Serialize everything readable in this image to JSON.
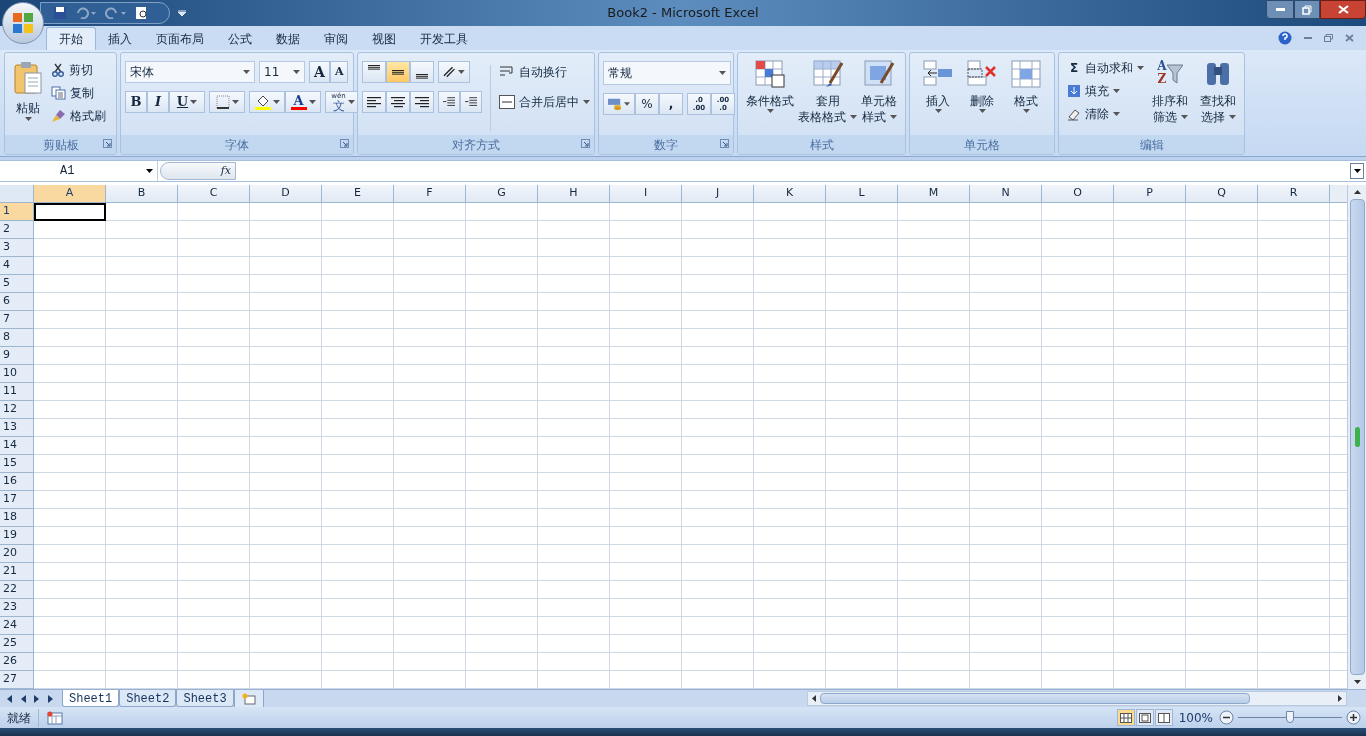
{
  "window": {
    "title": "Book2 - Microsoft Excel"
  },
  "tabs": [
    {
      "label": "开始",
      "selected": true
    },
    {
      "label": "插入",
      "selected": false
    },
    {
      "label": "页面布局",
      "selected": false
    },
    {
      "label": "公式",
      "selected": false
    },
    {
      "label": "数据",
      "selected": false
    },
    {
      "label": "审阅",
      "selected": false
    },
    {
      "label": "视图",
      "selected": false
    },
    {
      "label": "开发工具",
      "selected": false
    }
  ],
  "ribbon": {
    "groups": [
      {
        "kind": "clipboard",
        "label": "剪贴板",
        "paste": "粘贴",
        "commands": [
          "剪切",
          "复制",
          "格式刷"
        ]
      },
      {
        "kind": "font",
        "label": "字体",
        "font_name": "宋体",
        "font_size": "11",
        "grow": "A",
        "shrink": "A",
        "bold": "B",
        "italic": "I",
        "underline": "U",
        "font_color": "A",
        "phonetic_top": "wén",
        "phonetic": "文"
      },
      {
        "kind": "alignment",
        "label": "对齐方式",
        "vertical": [
          {
            "selected": false
          },
          {
            "selected": true
          },
          {
            "selected": false
          }
        ],
        "wrap_text": "自动换行",
        "merge": "合并后居中"
      },
      {
        "kind": "number",
        "label": "数字",
        "format": "常规",
        "percent": "%",
        "comma": ",",
        "decimals": [
          {
            "top": ".0",
            "bottom": ".00"
          },
          {
            "top": ".00",
            "bottom": ".0"
          }
        ]
      },
      {
        "kind": "styles",
        "label": "样式",
        "buttons": [
          [
            "条件格式"
          ],
          [
            "套用",
            "表格格式"
          ],
          [
            "单元格",
            "样式"
          ]
        ]
      },
      {
        "kind": "cells",
        "label": "单元格",
        "buttons": [
          "插入",
          "删除",
          "格式"
        ]
      },
      {
        "kind": "editing",
        "label": "编辑",
        "sigma": "Σ",
        "commands": [
          "自动求和",
          "填充",
          "清除"
        ],
        "sort_letters": [
          "A",
          "Z"
        ],
        "buttons": [
          [
            "排序和",
            "筛选"
          ],
          [
            "查找和",
            "选择"
          ]
        ]
      }
    ]
  },
  "formula_bar": {
    "name_box": "A1",
    "fx": "fx"
  },
  "columns": [
    {
      "label": "A",
      "selected": true
    },
    {
      "label": "B",
      "selected": false
    },
    {
      "label": "C",
      "selected": false
    },
    {
      "label": "D",
      "selected": false
    },
    {
      "label": "E",
      "selected": false
    },
    {
      "label": "F",
      "selected": false
    },
    {
      "label": "G",
      "selected": false
    },
    {
      "label": "H",
      "selected": false
    },
    {
      "label": "I",
      "selected": false
    },
    {
      "label": "J",
      "selected": false
    },
    {
      "label": "K",
      "selected": false
    },
    {
      "label": "L",
      "selected": false
    },
    {
      "label": "M",
      "selected": false
    },
    {
      "label": "N",
      "selected": false
    },
    {
      "label": "O",
      "selected": false
    },
    {
      "label": "P",
      "selected": false
    },
    {
      "label": "Q",
      "selected": false
    },
    {
      "label": "R",
      "selected": false
    }
  ],
  "rows": [
    {
      "label": "1",
      "selected": true
    },
    {
      "label": "2",
      "selected": false
    },
    {
      "label": "3",
      "selected": false
    },
    {
      "label": "4",
      "selected": false
    },
    {
      "label": "5",
      "selected": false
    },
    {
      "label": "6",
      "selected": false
    },
    {
      "label": "7",
      "selected": false
    },
    {
      "label": "8",
      "selected": false
    },
    {
      "label": "9",
      "selected": false
    },
    {
      "label": "10",
      "selected": false
    },
    {
      "label": "11",
      "selected": false
    },
    {
      "label": "12",
      "selected": false
    },
    {
      "label": "13",
      "selected": false
    },
    {
      "label": "14",
      "selected": false
    },
    {
      "label": "15",
      "selected": false
    },
    {
      "label": "16",
      "selected": false
    },
    {
      "label": "17",
      "selected": false
    },
    {
      "label": "18",
      "selected": false
    },
    {
      "label": "19",
      "selected": false
    },
    {
      "label": "20",
      "selected": false
    },
    {
      "label": "21",
      "selected": false
    },
    {
      "label": "22",
      "selected": false
    },
    {
      "label": "23",
      "selected": false
    },
    {
      "label": "24",
      "selected": false
    },
    {
      "label": "25",
      "selected": false
    },
    {
      "label": "26",
      "selected": false
    },
    {
      "label": "27",
      "selected": false
    }
  ],
  "sheets": [
    {
      "label": "Sheet1",
      "selected": true
    },
    {
      "label": "Sheet2",
      "selected": false
    },
    {
      "label": "Sheet3",
      "selected": false
    }
  ],
  "status_bar": {
    "status": "就绪",
    "views": [
      {
        "selected": true
      },
      {
        "selected": false
      },
      {
        "selected": false
      }
    ],
    "zoom": "100%",
    "zoom_level": {
      "level": 0.5
    }
  }
}
